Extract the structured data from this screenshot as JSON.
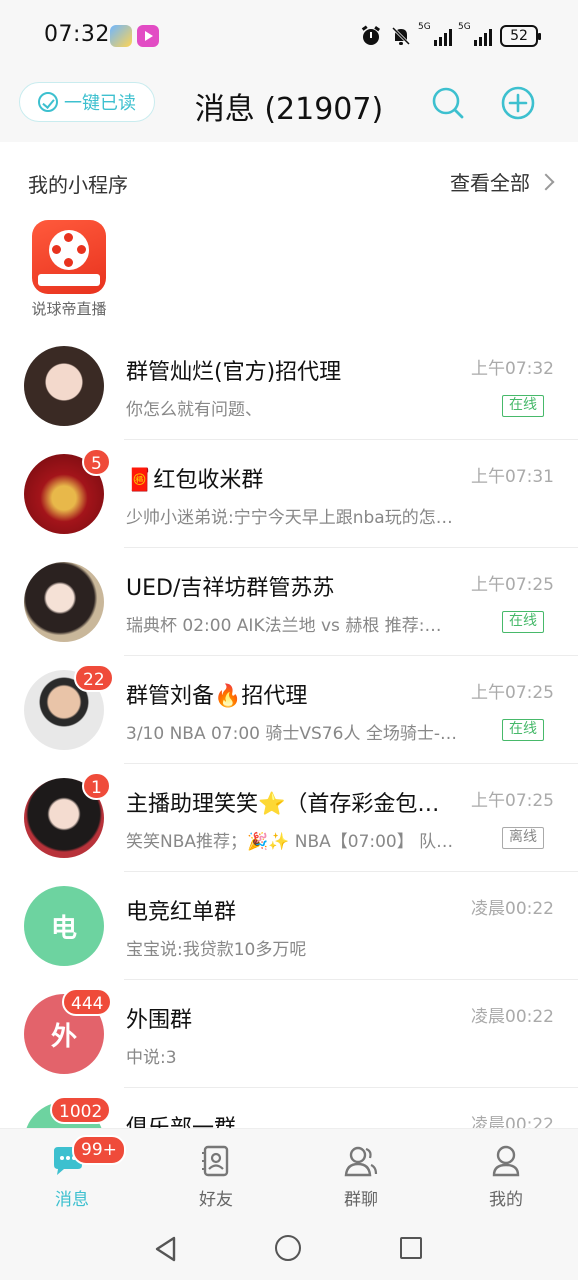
{
  "status_bar": {
    "time": "07:32",
    "net1": "5G",
    "net2": "5G",
    "battery": "52"
  },
  "header": {
    "mark_all_read": "一键已读",
    "title": "消息 (21907)",
    "accent": "#3dc0cf"
  },
  "mini_programs": {
    "title": "我的小程序",
    "view_all": "查看全部",
    "apps": [
      {
        "label": "说球帝直播"
      }
    ]
  },
  "chats": [
    {
      "name": "群管灿烂(官方)招代理",
      "time": "上午07:32",
      "message": "你怎么就有问题、",
      "status": "在线",
      "badge": ""
    },
    {
      "name": "🧧红包收米群",
      "time": "上午07:31",
      "message": "少帅小迷弟说:宁宁今天早上跟nba玩的怎…",
      "status": "",
      "badge": "5"
    },
    {
      "name": "UED/吉祥坊群管苏苏",
      "time": "上午07:25",
      "message": "瑞典杯  02:00 AIK法兰地 vs 赫根 推荐:…",
      "status": "在线",
      "badge": ""
    },
    {
      "name": "群管刘备🔥招代理",
      "time": "上午07:25",
      "message": "3/10 NBA 07:00 骑士VS76人 全场骑士-…",
      "status": "在线",
      "badge": "22"
    },
    {
      "name": "主播助理笑笑⭐（首存彩金包…",
      "time": "上午07:25",
      "message": "笑笑NBA推荐；🎉✨ NBA【07:00】 队…",
      "status": "离线",
      "badge": "1"
    },
    {
      "name": "电竞红单群",
      "time": "凌晨00:22",
      "message": "宝宝说:我贷款10多万呢",
      "status": "",
      "badge": "",
      "letter": "电"
    },
    {
      "name": "外围群",
      "time": "凌晨00:22",
      "message": "中说:3",
      "status": "",
      "badge": "444",
      "letter": "外"
    },
    {
      "name": "俱乐部一群",
      "time": "凌晨00:22",
      "message": "",
      "status": "",
      "badge": "1002"
    }
  ],
  "tabbar": {
    "messages": "消息",
    "messages_badge": "99+",
    "friends": "好友",
    "groups": "群聊",
    "mine": "我的"
  }
}
